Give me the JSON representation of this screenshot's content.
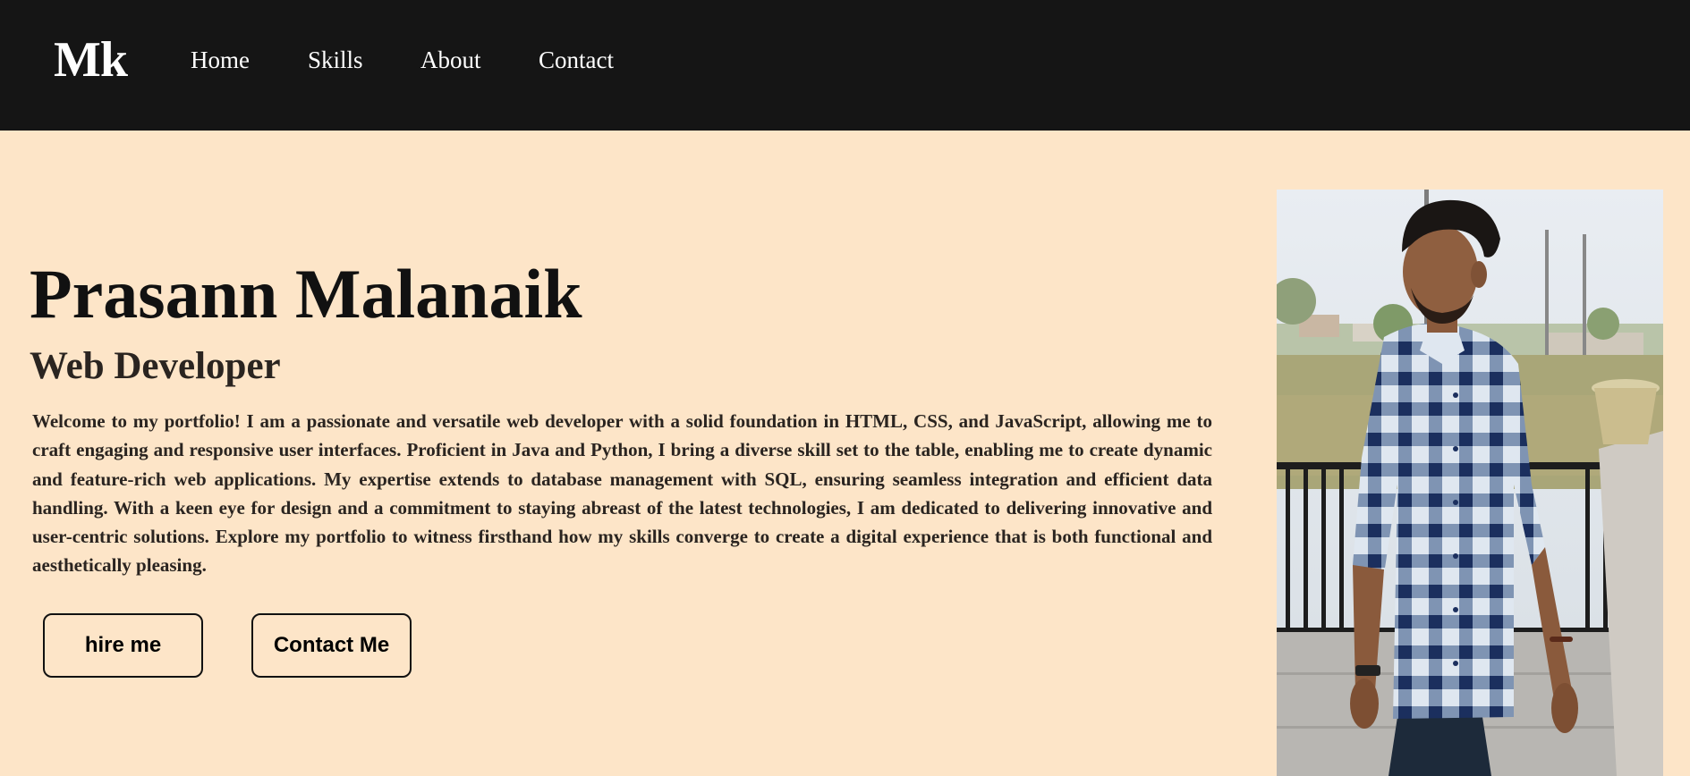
{
  "nav": {
    "logo": "Mk",
    "links": [
      {
        "label": "Home"
      },
      {
        "label": "Skills"
      },
      {
        "label": "About"
      },
      {
        "label": "Contact"
      }
    ]
  },
  "hero": {
    "name": "Prasann Malanaik",
    "role": "Web Developer",
    "bio": "Welcome to my portfolio! I am a passionate and versatile web developer with a solid foundation in HTML, CSS, and JavaScript, allowing me to craft engaging and responsive user interfaces. Proficient in Java and Python, I bring a diverse skill set to the table, enabling me to create dynamic and feature-rich web applications. My expertise extends to database management with SQL, ensuring seamless integration and efficient data handling. With a keen eye for design and a commitment to staying abreast of the latest technologies, I am dedicated to delivering innovative and user-centric solutions. Explore my portfolio to witness firsthand how my skills converge to create a digital experience that is both functional and aesthetically pleasing.",
    "buttons": {
      "hire": "hire me",
      "contact": "Contact Me"
    }
  },
  "colors": {
    "navbar_bg": "#151515",
    "page_bg": "#fde5c8",
    "text_dark": "#111111"
  }
}
